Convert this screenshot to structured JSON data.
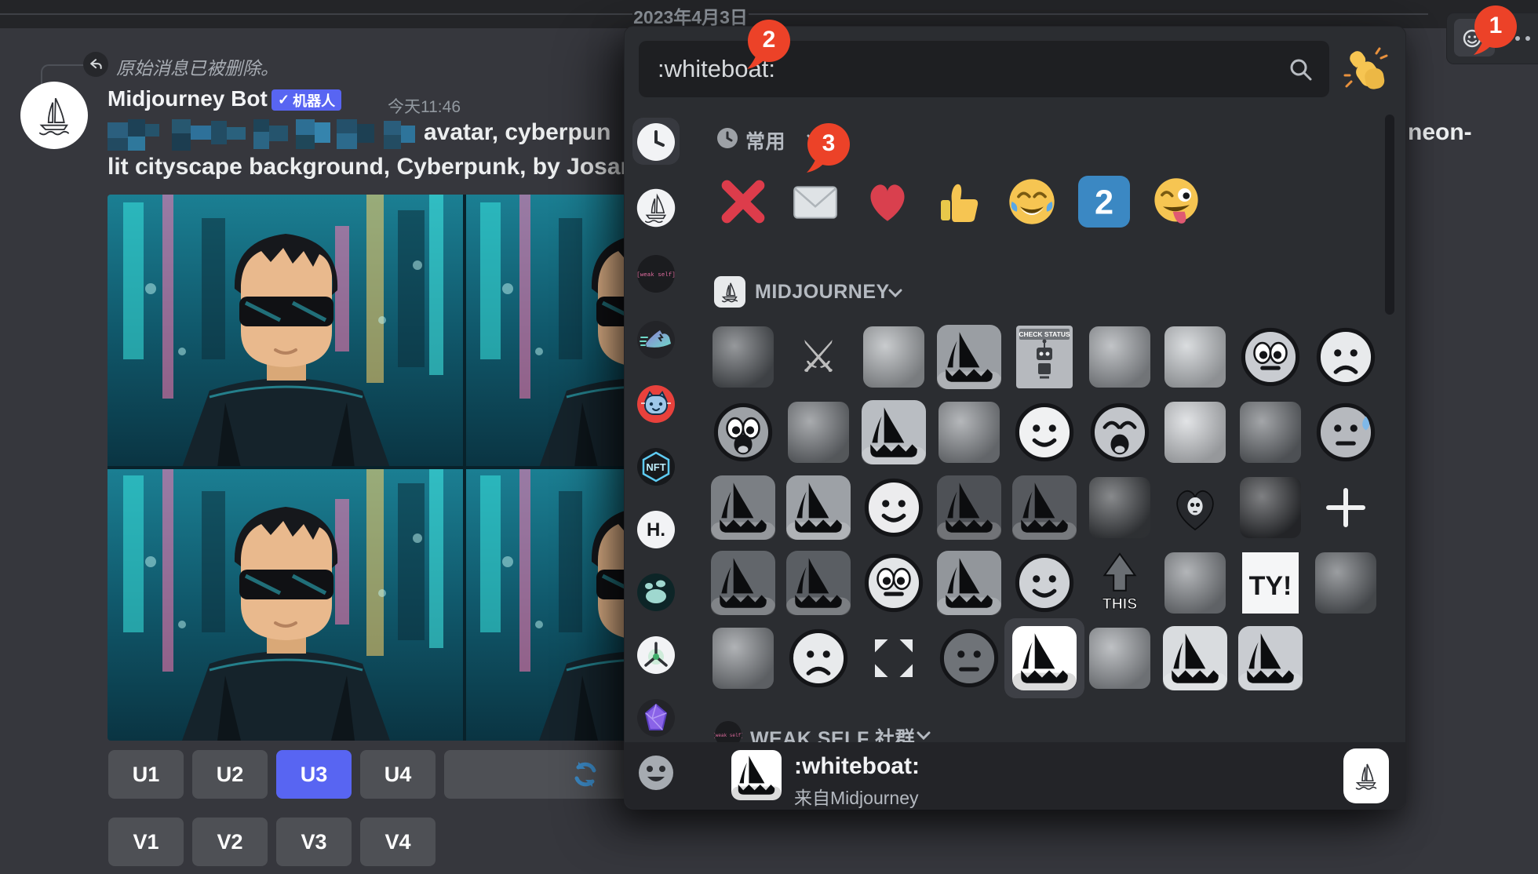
{
  "page": {
    "date_divider": "2023年4月3日"
  },
  "toolbar": {
    "badge": "1"
  },
  "annotations": {
    "one": "1",
    "two": "2",
    "three": "3"
  },
  "message": {
    "reply_notice": "原始消息已被删除。",
    "author": "Midjourney Bot",
    "bot_badge_check": "✓",
    "bot_badge": "机器人",
    "timestamp": "今天11:46",
    "prompt_visible_left": "avatar, cyberpun",
    "prompt_visible_right": "neon-",
    "prompt_line2": "lit cityscape background, Cyberpunk, by Josan",
    "upscale_buttons": [
      "U1",
      "U2",
      "U3",
      "U4"
    ],
    "active_upscale": "U3",
    "variation_buttons": [
      "V1",
      "V2",
      "V3",
      "V4"
    ]
  },
  "picker": {
    "search_value": ":whiteboat:",
    "frequent_section": {
      "label": "常用",
      "emojis": [
        {
          "name": "cross-mark-emoji",
          "kind": "cross"
        },
        {
          "name": "envelope-emoji",
          "kind": "envelope"
        },
        {
          "name": "red-heart-emoji",
          "kind": "heart"
        },
        {
          "name": "thumbs-up-emoji",
          "kind": "thumb"
        },
        {
          "name": "joy-emoji",
          "kind": "joy"
        },
        {
          "name": "keycap-2-emoji",
          "kind": "two",
          "label": "2"
        },
        {
          "name": "zany-face-emoji",
          "kind": "zany"
        }
      ]
    },
    "midjourney_section": {
      "label": "MIDJOURNEY",
      "emojis": [
        {
          "name": "blob-monster-emoji",
          "kind": "photo",
          "bg": "#565a5f"
        },
        {
          "name": "dagger-emoji",
          "kind": "glyph",
          "g": "⚔"
        },
        {
          "name": "dog-emoji",
          "kind": "photo",
          "bg": "#a8acb0"
        },
        {
          "name": "gray-boat-emoji",
          "kind": "boat",
          "bg": "#9a9ea3"
        },
        {
          "name": "check-status-robot-emoji",
          "kind": "checkstatus",
          "caption": "CHECK STATUS"
        },
        {
          "name": "doge-emoji",
          "kind": "photo",
          "bg": "#9ca0a5"
        },
        {
          "name": "octopus-facepalm-emoji",
          "kind": "photo",
          "bg": "#c4c8cc"
        },
        {
          "name": "wide-eyes-emoji",
          "kind": "face",
          "bg": "#c9ccd1",
          "eyes": "big",
          "mouth": "flat"
        },
        {
          "name": "sad-ghost-emoji",
          "kind": "face",
          "bg": "#e8eaec",
          "eyes": "dot",
          "mouth": "frown"
        },
        {
          "name": "scream-face-emoji",
          "kind": "face",
          "bg": "#9da1a6",
          "eyes": "big",
          "mouth": "open"
        },
        {
          "name": "glowing-head-emoji",
          "kind": "photo",
          "bg": "#74787d"
        },
        {
          "name": "boat-light-emoji",
          "kind": "boat",
          "bg": "#b9bdc2"
        },
        {
          "name": "wolf-emoji",
          "kind": "photo",
          "bg": "#888c91"
        },
        {
          "name": "doodle-smiley-emoji",
          "kind": "face",
          "bg": "#f0f1f2",
          "eyes": "dot",
          "mouth": "smile"
        },
        {
          "name": "laughing-mask-emoji",
          "kind": "face",
          "bg": "#c2c5ca",
          "eyes": "closed",
          "mouth": "open"
        },
        {
          "name": "cat-squish-emoji",
          "kind": "photo",
          "bg": "#d0d3d7"
        },
        {
          "name": "muscle-man-emoji",
          "kind": "photo",
          "bg": "#6b6f74"
        },
        {
          "name": "sweat-blob-emoji",
          "kind": "face",
          "bg": "#b6b9be",
          "eyes": "dot",
          "mouth": "flat",
          "extra": "sweat"
        },
        {
          "name": "boat-emoji-1",
          "kind": "boat",
          "bg": "#7b7f84"
        },
        {
          "name": "boat-emoji-2",
          "kind": "boat",
          "bg": "#9da1a6"
        },
        {
          "name": "blob-smiley-emoji",
          "kind": "face",
          "bg": "#ececee",
          "eyes": "dot",
          "mouth": "smile"
        },
        {
          "name": "boat-dark-emoji-1",
          "kind": "boat",
          "bg": "#4e5156"
        },
        {
          "name": "boat-dark-emoji-2",
          "kind": "boat",
          "bg": "#56595e"
        },
        {
          "name": "plague-doctor-emoji",
          "kind": "photo",
          "bg": "#3f4246"
        },
        {
          "name": "skull-heart-emoji",
          "kind": "heartskull"
        },
        {
          "name": "plague-figure-emoji",
          "kind": "photo",
          "bg": "#303236"
        },
        {
          "name": "plus-emoji",
          "kind": "plus"
        },
        {
          "name": "boat-emoji-3",
          "kind": "boat",
          "bg": "#62666b"
        },
        {
          "name": "boat-emoji-4",
          "kind": "boat",
          "bg": "#5a5e63"
        },
        {
          "name": "nervous-blob-emoji",
          "kind": "face",
          "bg": "#e3e5e7",
          "eyes": "big",
          "mouth": "flat"
        },
        {
          "name": "boat-emoji-5",
          "kind": "boat",
          "bg": "#92969b"
        },
        {
          "name": "ghost-smiley-emoji",
          "kind": "face",
          "bg": "#cfd2d6",
          "eyes": "dot",
          "mouth": "smile"
        },
        {
          "name": "this-arrow-emoji",
          "kind": "this",
          "label": "THIS"
        },
        {
          "name": "angry-rock-emoji",
          "kind": "photo",
          "bg": "#84888d"
        },
        {
          "name": "ty-emoji",
          "kind": "ty",
          "label": "TY!"
        },
        {
          "name": "explosion-emoji",
          "kind": "photo",
          "bg": "#5e6267"
        },
        {
          "name": "smoke-emoji",
          "kind": "photo",
          "bg": "#808489"
        },
        {
          "name": "frown-doodle-emoji",
          "kind": "face",
          "bg": "#e8eaec",
          "eyes": "dot",
          "mouth": "frown"
        },
        {
          "name": "expand-arrows-emoji",
          "kind": "expand"
        },
        {
          "name": "moon-face-emoji",
          "kind": "face",
          "bg": "#6f7378",
          "eyes": "dot",
          "mouth": "flat"
        },
        {
          "name": "whiteboat-emoji",
          "kind": "boat",
          "bg": "#ffffff",
          "selected": true
        },
        {
          "name": "robot-statue-emoji",
          "kind": "photo",
          "bg": "#979ba0"
        },
        {
          "name": "boat-light-emoji-2",
          "kind": "boat",
          "bg": "#d9dcdf"
        },
        {
          "name": "boat-light-emoji-3",
          "kind": "boat",
          "bg": "#c9ccd1"
        },
        {
          "name": "empty",
          "kind": "empty"
        }
      ]
    },
    "weakself_section": {
      "label": "WEAK SELF 社群"
    },
    "preview": {
      "emoji_name": ":whiteboat:",
      "source": "来自Midjourney"
    },
    "sidebar": [
      {
        "name": "category-frequent",
        "kind": "clock"
      },
      {
        "name": "category-midjourney",
        "kind": "lineboat"
      },
      {
        "name": "category-weakself",
        "kind": "weakself",
        "label": "[weak self]"
      },
      {
        "name": "category-sneaker",
        "kind": "shoe"
      },
      {
        "name": "category-cat-server",
        "kind": "cat"
      },
      {
        "name": "category-nft",
        "kind": "nft",
        "label": "NFT"
      },
      {
        "name": "category-h-server",
        "kind": "h",
        "label": "H."
      },
      {
        "name": "category-paw",
        "kind": "paw"
      },
      {
        "name": "category-molecule",
        "kind": "y"
      },
      {
        "name": "category-gem",
        "kind": "gem"
      },
      {
        "name": "category-standard-emoji",
        "kind": "smiley"
      }
    ]
  },
  "colors": {
    "accent": "#5865f2",
    "badge_red": "#ec4228",
    "panel": "#2b2d31",
    "input": "#1e1f22",
    "refresh_blue": "#3b88c3"
  }
}
